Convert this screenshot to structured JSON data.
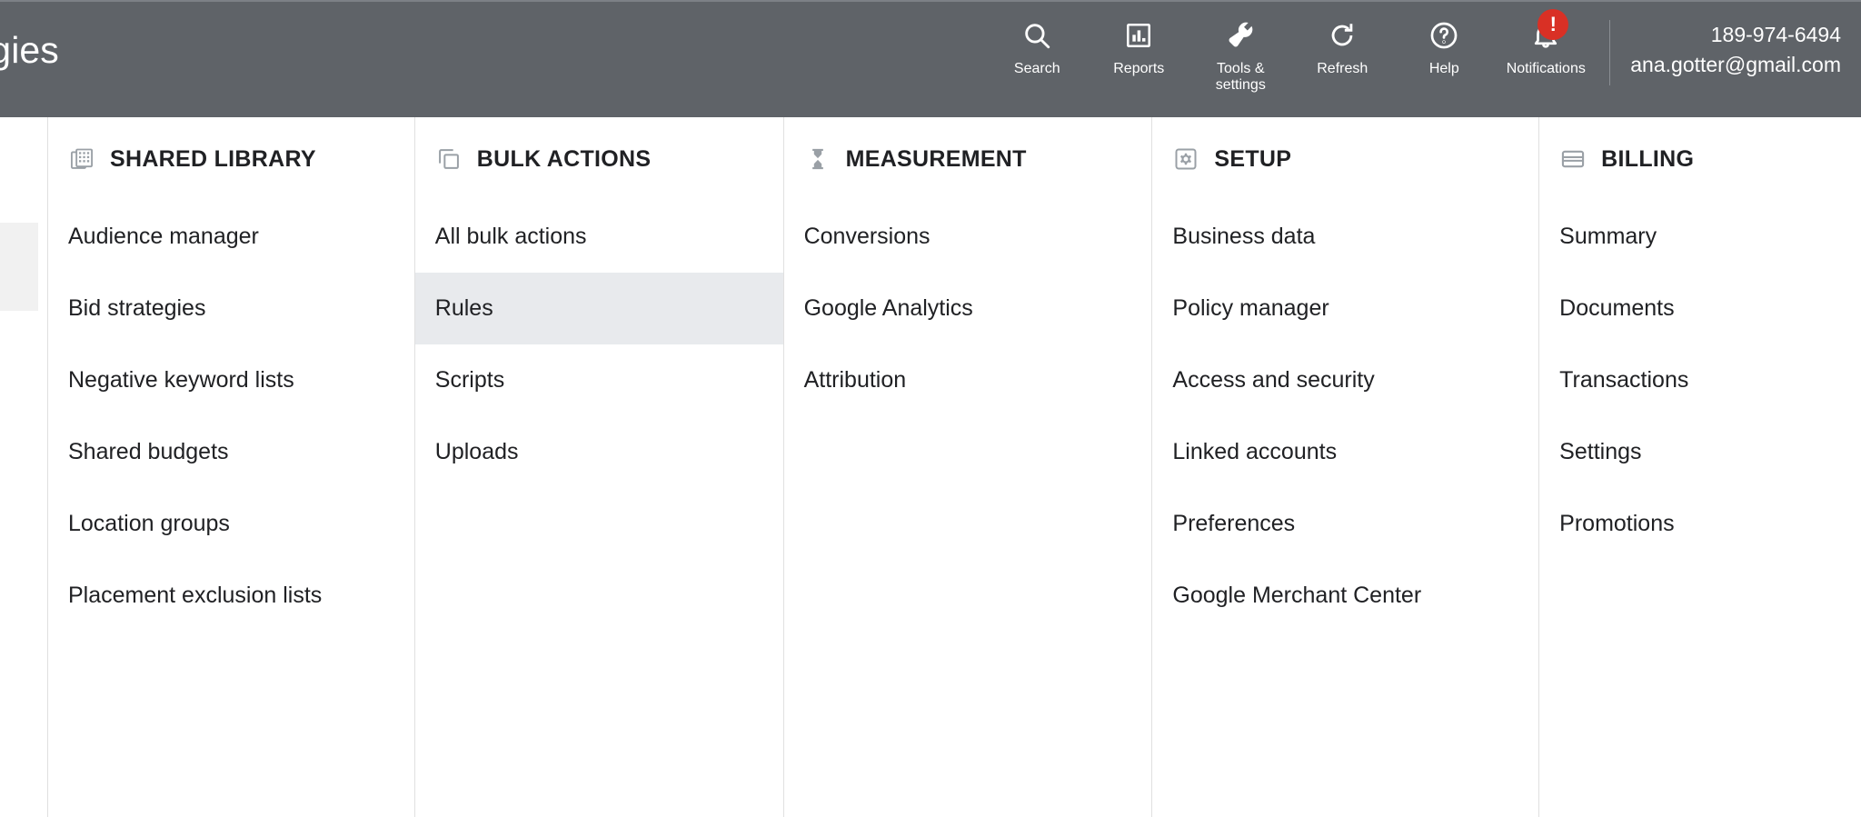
{
  "topbar": {
    "background_color": "#5f6368",
    "page_title_truncated": "ategies",
    "tools": [
      {
        "icon": "search-icon",
        "label": "Search"
      },
      {
        "icon": "reports-bar-chart-icon",
        "label": "Reports"
      },
      {
        "icon": "wrench-tools-icon",
        "label": "Tools &\nsettings"
      },
      {
        "icon": "refresh-icon",
        "label": "Refresh"
      },
      {
        "icon": "help-question-icon",
        "label": "Help"
      },
      {
        "icon": "notifications-bell-icon",
        "label": "Notifications",
        "badge": "!"
      }
    ],
    "tools_labels": {
      "search": "Search",
      "reports": "Reports",
      "tools_settings_line1": "Tools &",
      "tools_settings_line2": "settings",
      "refresh": "Refresh",
      "help": "Help",
      "notifications": "Notifications"
    },
    "notification_badge": "!",
    "notification_badge_color": "#d93025",
    "account": {
      "id": "189-974-6494",
      "email": "ana.gotter@gmail.com"
    }
  },
  "menu": {
    "highlight_color": "#e8eaed",
    "columns": [
      {
        "id": "shared-library",
        "icon": "shared-library-grid-icon",
        "header": "SHARED LIBRARY",
        "items": [
          "Audience manager",
          "Bid strategies",
          "Negative keyword lists",
          "Shared budgets",
          "Location groups",
          "Placement exclusion lists"
        ]
      },
      {
        "id": "bulk-actions",
        "icon": "bulk-actions-copy-icon",
        "header": "BULK ACTIONS",
        "items": [
          "All bulk actions",
          "Rules",
          "Scripts",
          "Uploads"
        ],
        "highlighted_item": "Rules"
      },
      {
        "id": "measurement",
        "icon": "measurement-hourglass-icon",
        "header": "MEASUREMENT",
        "items": [
          "Conversions",
          "Google Analytics",
          "Attribution"
        ]
      },
      {
        "id": "setup",
        "icon": "setup-gear-icon",
        "header": "SETUP",
        "items": [
          "Business data",
          "Policy manager",
          "Access and security",
          "Linked accounts",
          "Preferences",
          "Google Merchant Center"
        ]
      },
      {
        "id": "billing",
        "icon": "billing-credit-card-icon",
        "header": "BILLING",
        "items": [
          "Summary",
          "Documents",
          "Transactions",
          "Settings",
          "Promotions"
        ]
      }
    ]
  }
}
